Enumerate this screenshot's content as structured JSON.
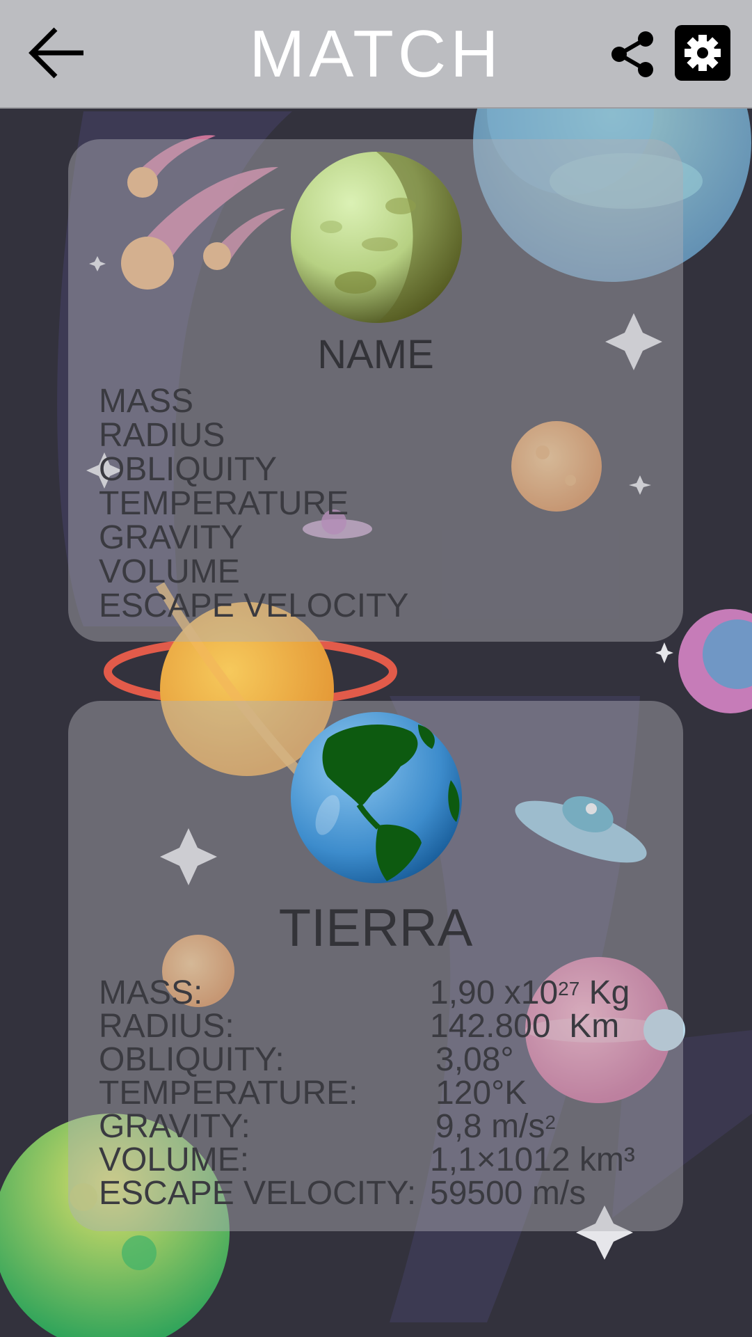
{
  "header": {
    "title": "MATCH",
    "back_icon": "arrow-left-icon",
    "share_icon": "share-icon",
    "settings_icon": "gear-icon"
  },
  "top_card": {
    "planet_icon": "green-planet",
    "name": "NAME",
    "labels": [
      "MASS",
      "RADIUS",
      "OBLIQUITY",
      "TEMPERATURE",
      "GRAVITY",
      "VOLUME",
      "ESCAPE VELOCITY"
    ]
  },
  "bottom_card": {
    "planet_icon": "earth-planet",
    "name": "TIERRA",
    "stats": {
      "mass": {
        "label": "MASS:",
        "value": "1,90 x10",
        "exp": "27",
        "unit": "Kg"
      },
      "radius": {
        "label": "RADIUS:",
        "value": "142.800  Km"
      },
      "obliquity": {
        "label": "OBLIQUITY:",
        "value": "3,08°"
      },
      "temperature": {
        "label": "TEMPERATURE:",
        "value": "120°K"
      },
      "gravity": {
        "label": "GRAVITY:",
        "value": "9,8 m/s",
        "exp": "2"
      },
      "volume": {
        "label": "VOLUME:",
        "value": "1,1×1012 km³"
      },
      "escape_velocity": {
        "label": "ESCAPE VELOCITY:",
        "value": "59500 m/s"
      }
    }
  },
  "colors": {
    "header_bg": "#bcbdc1",
    "page_bg": "#33323d",
    "text": "#3a3a40"
  }
}
